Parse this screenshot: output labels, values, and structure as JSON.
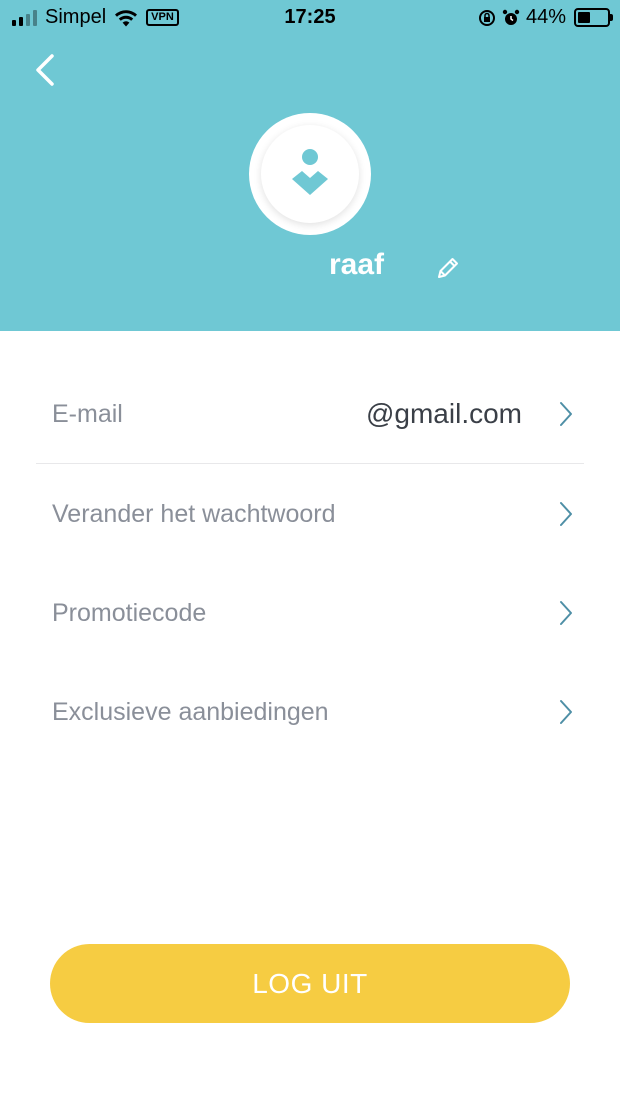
{
  "status_bar": {
    "carrier": "Simpel",
    "vpn_label": "VPN",
    "time": "17:25",
    "battery_percent_text": "44%",
    "battery_level": 0.44
  },
  "header": {
    "background_color": "#6fc8d4",
    "back_icon": "chevron-left-icon",
    "avatar_icon": "user-avatar-icon",
    "username": "raaf",
    "edit_icon": "pencil-icon"
  },
  "settings": {
    "items": [
      {
        "label": "E-mail",
        "value": "@gmail.com",
        "icon": "chevron-right-icon"
      },
      {
        "label": "Verander het wachtwoord",
        "value": "",
        "icon": "chevron-right-icon"
      },
      {
        "label": "Promotiecode",
        "value": "",
        "icon": "chevron-right-icon"
      },
      {
        "label": "Exclusieve aanbiedingen",
        "value": "",
        "icon": "chevron-right-icon"
      }
    ]
  },
  "logout": {
    "label": "LOG UIT",
    "color": "#f6cc42"
  }
}
